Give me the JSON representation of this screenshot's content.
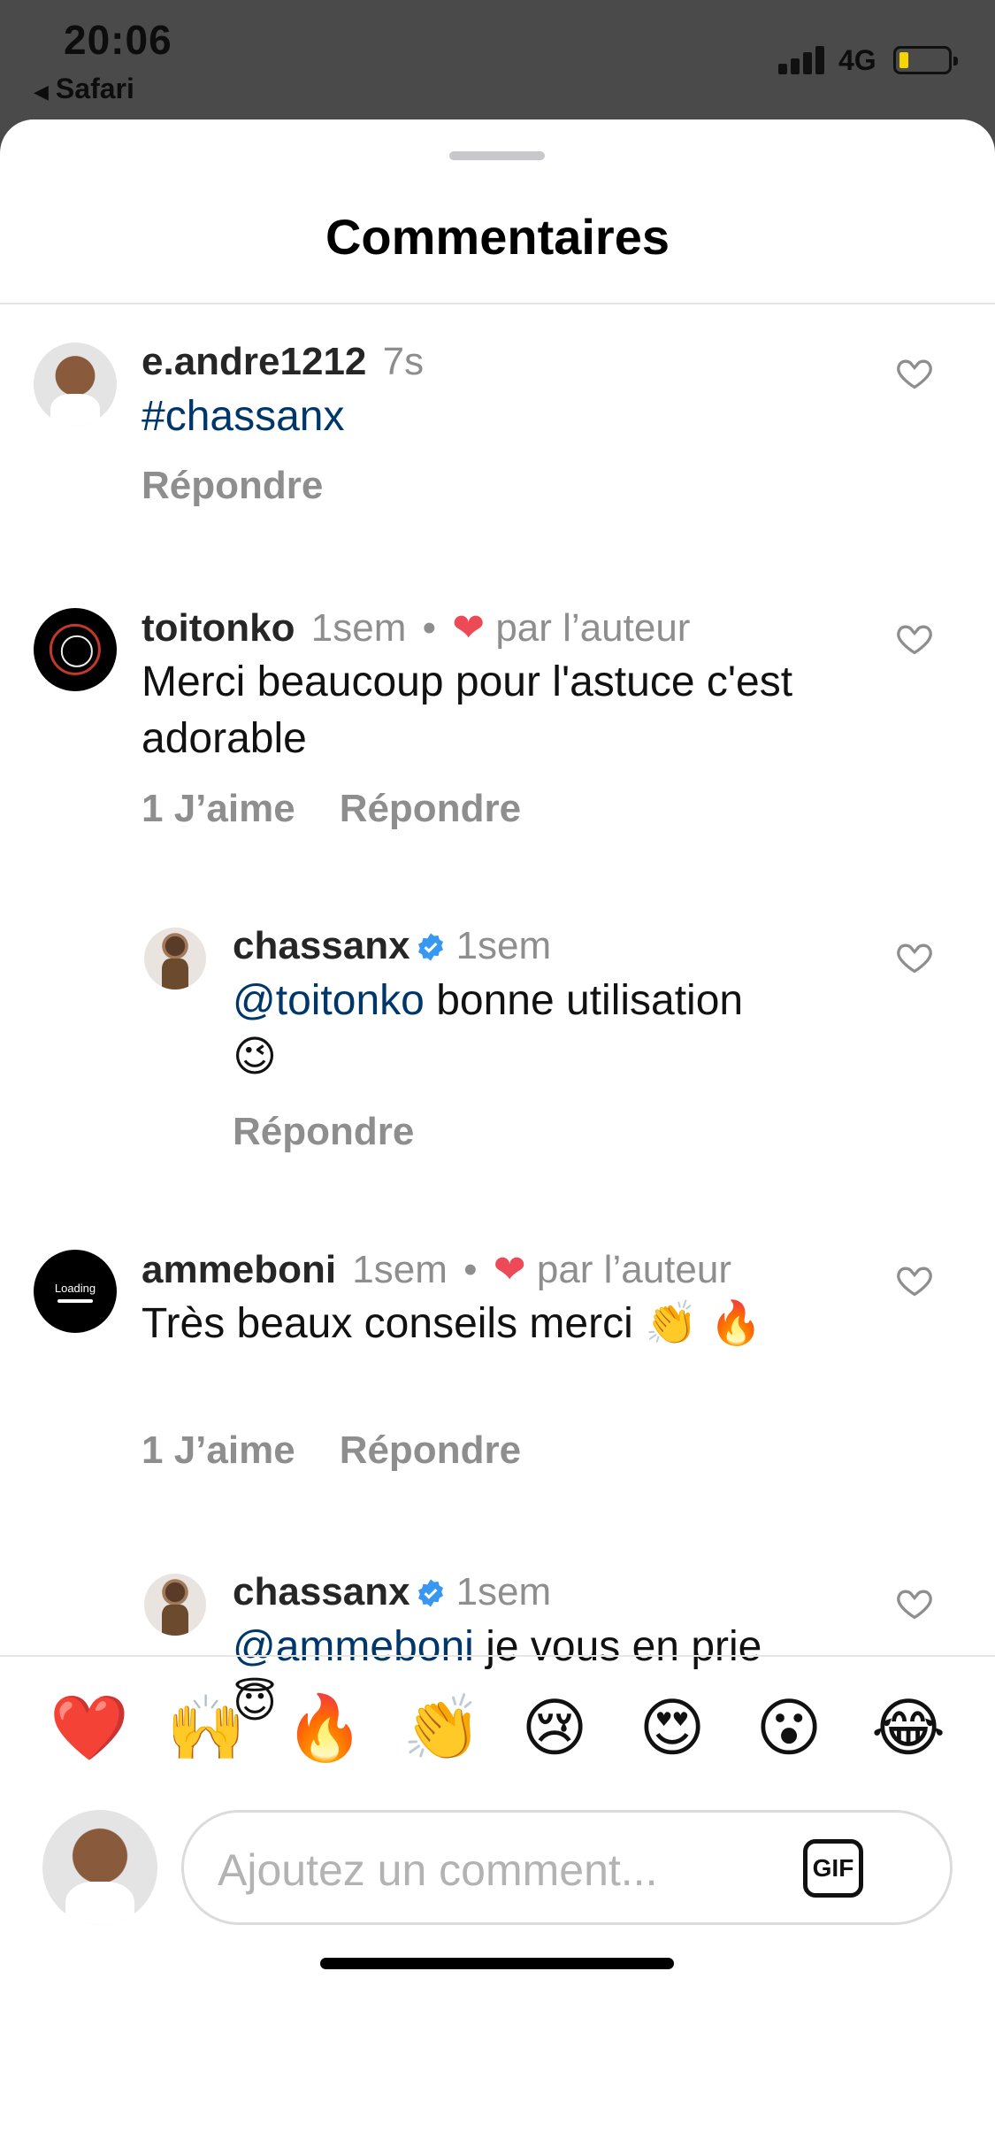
{
  "status_bar": {
    "time": "20:06",
    "back_app": "Safari",
    "network": "4G"
  },
  "sheet": {
    "title": "Commentaires"
  },
  "comments": [
    {
      "username": "e.andre1212",
      "time": "7s",
      "text": "#chassanx",
      "actions": [
        "Répondre"
      ],
      "liked_by_author": false
    },
    {
      "username": "toitonko",
      "time": "1sem",
      "author_like_text": "par l’auteur",
      "text": "Merci beaucoup pour l'astuce c'est adorable",
      "likes_label": "1 J’aime",
      "reply_label": "Répondre"
    },
    {
      "username": "chassanx",
      "verified": true,
      "time": "1sem",
      "mention": "@toitonko",
      "text": "bonne utilisation",
      "emoji": "😉",
      "reply_label": "Répondre"
    },
    {
      "username": "ammeboni",
      "time": "1sem",
      "author_like_text": "par l’auteur",
      "text": "Très beaux conseils merci",
      "emoji": "👏 🔥",
      "likes_label": "1 J’aime",
      "reply_label": "Répondre",
      "avatar_text": "Loading"
    },
    {
      "username": "chassanx",
      "verified": true,
      "time": "1sem",
      "mention": "@ammeboni",
      "text": "je vous en prie",
      "emoji": "😇"
    }
  ],
  "emoji_bar": [
    "❤️",
    "🙌",
    "🔥",
    "👏",
    "😢",
    "😍",
    "😮",
    "😂"
  ],
  "composer": {
    "placeholder": "Ajoutez un comment...",
    "gif_label": "GIF"
  },
  "colors": {
    "link": "#00376b",
    "muted": "#8e8e8e",
    "heart": "#ed4956",
    "verified": "#3897f0"
  }
}
